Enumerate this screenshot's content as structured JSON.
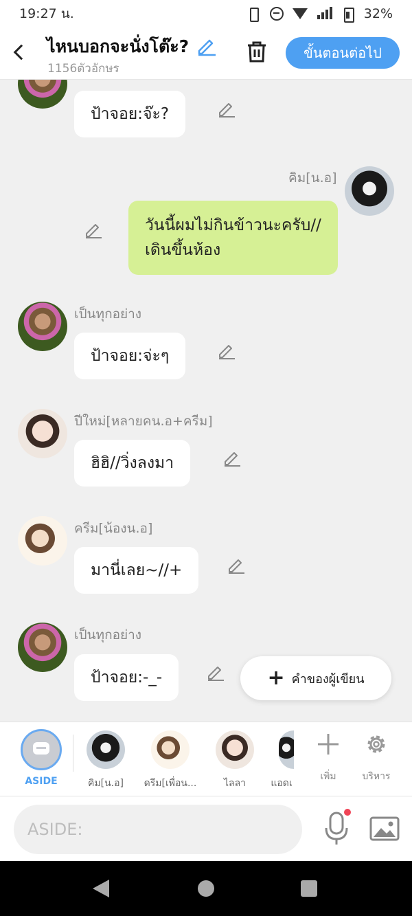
{
  "status_bar": {
    "time": "19:27 น.",
    "battery": "32%"
  },
  "header": {
    "title": "ไหนบอกจะนั่งโต๊ะ?",
    "char_count": "1156ตัวอักษร",
    "next_label": "ขั้นตอนต่อไป",
    "accent": "#4ea0f2"
  },
  "messages": [
    {
      "sender": "",
      "text": "ป้าจอย:จ๊ะ?"
    },
    {
      "sender": "คิม[น.อ]",
      "text": "วันนี้ผมไม่กินข้าวนะครับ//เดินขึ้นห้อง"
    },
    {
      "sender": "เป็นทุกอย่าง",
      "text": "ป้าจอย:จ่ะๆ"
    },
    {
      "sender": "ปีใหม่[หลายคน.อ+ครีม]",
      "text": "ฮิฮิ//วิ่งลงมา"
    },
    {
      "sender": "ครีม[น้องน.อ]",
      "text": "มานี่เลย~//+"
    },
    {
      "sender": "เป็นทุกอย่าง",
      "text": "ป้าจอย:-_-"
    }
  ],
  "author_button": {
    "label": "คำของผู้เขียน"
  },
  "characters": {
    "aside": "ASIDE",
    "items": [
      "คิม[น.อ]",
      "ดรีม[เพื่อน...",
      "ไลลา",
      "แอดเ"
    ],
    "add_label": "เพิ่ม",
    "manage_label": "บริหาร"
  },
  "input": {
    "placeholder": "ASIDE:"
  }
}
